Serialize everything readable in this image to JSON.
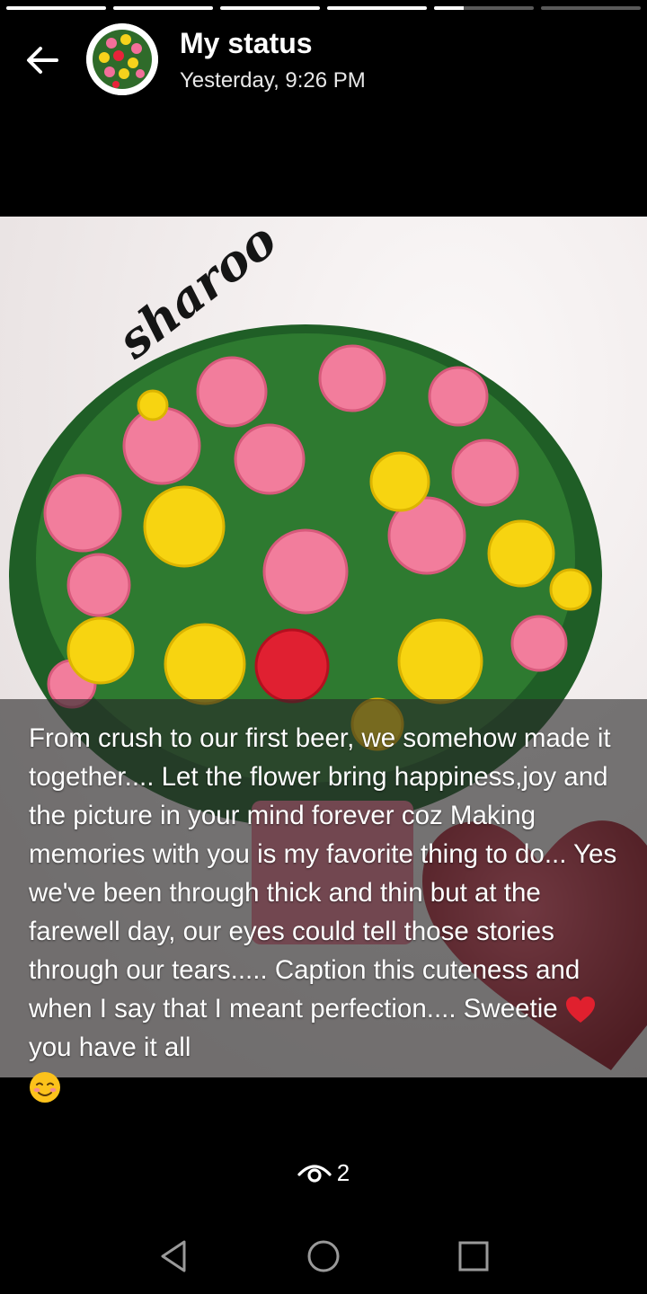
{
  "status_header": {
    "title": "My status",
    "timestamp": "Yesterday, 9:26 PM"
  },
  "progress": {
    "segments": [
      1,
      1,
      1,
      1,
      0.3,
      0
    ]
  },
  "photo": {
    "watermark": "sharoo"
  },
  "caption": {
    "text": "From crush to our first beer, we somehow made it together.... Let the flower bring happiness,joy and the picture in your mind forever coz Making memories with you is my favorite thing to do... Yes we've been through thick and thin but at the farewell day, our eyes could tell those stories through our tears..... Caption this cuteness and when I say that I meant perfection.... Sweetie",
    "text_end": " you have it all",
    "emoji_heart": "heart-emoji",
    "emoji_smile": "smiling-face-emoji"
  },
  "views": {
    "icon": "eye-icon",
    "count": "2"
  },
  "navbar": {
    "back_icon": "triangle-back-icon",
    "home_icon": "circle-home-icon",
    "recents_icon": "square-recents-icon"
  },
  "colors": {
    "background": "#000000",
    "caption_overlay": "#282828",
    "progress_active": "#ffffff"
  }
}
